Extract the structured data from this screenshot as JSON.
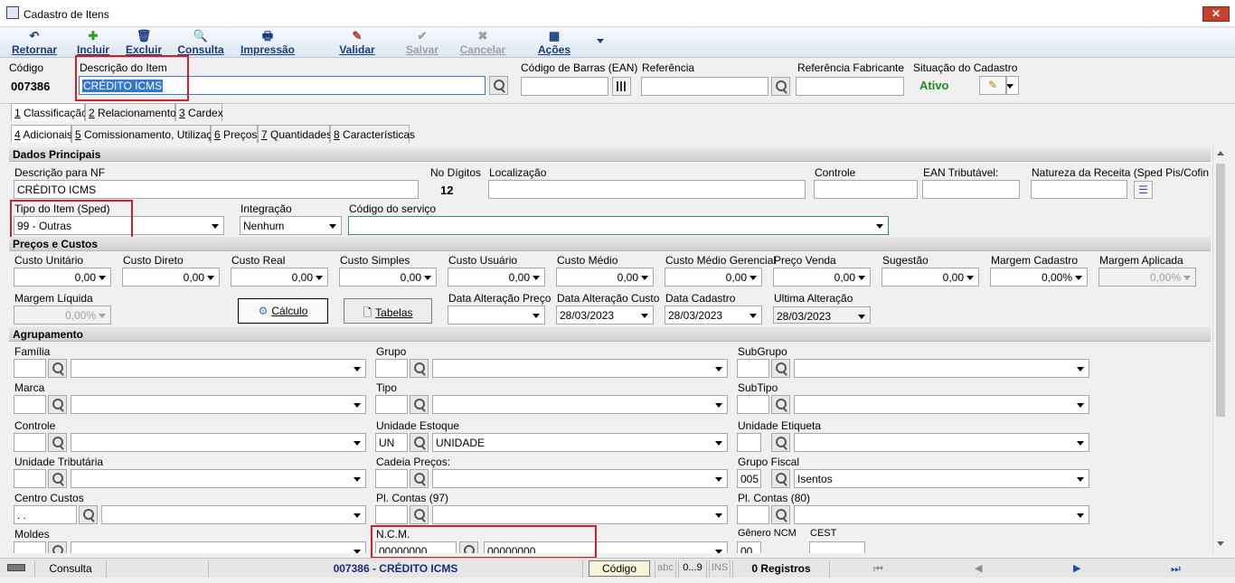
{
  "window": {
    "title": "Cadastro de Itens",
    "close": "✕"
  },
  "toolbar": [
    {
      "label": "Retornar",
      "icon": "↶",
      "enabled": true
    },
    {
      "label": "Incluir",
      "icon": "✚",
      "enabled": true
    },
    {
      "label": "Excluir",
      "icon": "🗑",
      "enabled": true
    },
    {
      "label": "Consulta",
      "icon": "🔍",
      "enabled": true
    },
    {
      "label": "Impressão",
      "icon": "🖶",
      "enabled": true
    },
    {
      "label": "Validar",
      "icon": "✎",
      "enabled": true
    },
    {
      "label": "Salvar",
      "icon": "✔",
      "enabled": false
    },
    {
      "label": "Cancelar",
      "icon": "✖",
      "enabled": false
    },
    {
      "label": "Ações",
      "icon": "▦",
      "enabled": true
    }
  ],
  "header": {
    "codigo_label": "Código",
    "codigo_value": "007386",
    "descricao_label": "Descrição do Item",
    "descricao_value": "CRÉDITO ICMS",
    "ean_label": "Código de Barras (EAN)",
    "ean_value": "",
    "referencia_label": "Referência",
    "referencia_value": "",
    "ref_fab_label": "Referência Fabricante",
    "ref_fab_value": "",
    "situacao_label": "Situação do Cadastro",
    "situacao_value": "Ativo"
  },
  "tabs_row1": [
    {
      "num": "1",
      "label": " Classificação"
    },
    {
      "num": "2",
      "label": " Relacionamentos"
    },
    {
      "num": "3",
      "label": " Cardex"
    }
  ],
  "tabs_row2": [
    {
      "num": "4",
      "label": " Adicionais"
    },
    {
      "num": "5",
      "label": " Comissionamento, Utilização"
    },
    {
      "num": "6",
      "label": " Preços"
    },
    {
      "num": "7",
      "label": " Quantidades"
    },
    {
      "num": "8",
      "label": " Características"
    }
  ],
  "dados": {
    "title": "Dados Principais",
    "desc_nf_label": "Descrição para NF",
    "desc_nf_value": "CRÉDITO ICMS",
    "no_digitos_label": "No Dígitos",
    "no_digitos_value": "12",
    "localizacao_label": "Localização",
    "localizacao_value": "",
    "controle_label": "Controle",
    "controle_value": "",
    "ean_trib_label": "EAN Tributável:",
    "ean_trib_value": "",
    "natureza_label": "Natureza da Receita (Sped Pis/Cofins",
    "natureza_value": "",
    "tipo_label": "Tipo do Item (Sped)",
    "tipo_value": "99 - Outras",
    "integracao_label": "Integração",
    "integracao_value": "Nenhum",
    "servico_label": "Código do serviço",
    "servico_value": ""
  },
  "precos": {
    "title": "Preços e Custos",
    "row1": [
      {
        "label": "Custo Unitário",
        "value": "0,00",
        "disabled": false
      },
      {
        "label": "Custo Direto",
        "value": "0,00",
        "disabled": false
      },
      {
        "label": "Custo Real",
        "value": "0,00",
        "disabled": false
      },
      {
        "label": "Custo Simples",
        "value": "0,00",
        "disabled": false
      },
      {
        "label": "Custo Usuário",
        "value": "0,00",
        "disabled": false
      },
      {
        "label": "Custo Médio",
        "value": "0,00",
        "disabled": false
      },
      {
        "label": "Custo Médio Gerencial",
        "value": "0,00",
        "disabled": false
      },
      {
        "label": "Preço Venda",
        "value": "0,00",
        "disabled": false
      },
      {
        "label": "Sugestão",
        "value": "0,00",
        "disabled": false
      },
      {
        "label": "Margem Cadastro",
        "value": "0,00%",
        "disabled": false
      },
      {
        "label": "Margem Aplicada",
        "value": "0,00%",
        "disabled": true
      }
    ],
    "margem_liq_label": "Margem Líquida",
    "margem_liq_value": "0,00%",
    "calculo_label": "Cálculo",
    "tabelas_label": "Tabelas",
    "dates": [
      {
        "label": "Data Alteração Preço",
        "value": ""
      },
      {
        "label": "Data Alteração Custo",
        "value": "28/03/2023"
      },
      {
        "label": "Data Cadastro",
        "value": "28/03/2023"
      },
      {
        "label": "Ultima Alteração",
        "value": "28/03/2023"
      }
    ]
  },
  "agrup": {
    "title": "Agrupamento",
    "familia": "Família",
    "grupo": "Grupo",
    "subgrupo": "SubGrupo",
    "marca": "Marca",
    "tipo": "Tipo",
    "subtipo": "SubTipo",
    "controle": "Controle",
    "unid_estoque": "Unidade Estoque",
    "unid_estoque_code": "UN",
    "unid_estoque_desc": "UNIDADE",
    "unid_etiqueta": "Unidade Etiqueta",
    "unid_trib": "Unidade Tributária",
    "cadeia": "Cadeia Preços:",
    "grupo_fiscal": "Grupo Fiscal",
    "grupo_fiscal_code": "005",
    "grupo_fiscal_desc": "Isentos",
    "centro_custos": "Centro Custos",
    "centro_custos_value": " .  .",
    "pl_contas97": "Pl. Contas (97)",
    "pl_contas80": "Pl. Contas (80)",
    "moldes": "Moldes",
    "ncm": "N.C.M.",
    "ncm_code": "00000000",
    "ncm_desc": "00000000",
    "genero_ncm": "Gênero NCM",
    "genero_value": "00",
    "cest": "CEST"
  },
  "status": {
    "mode": "Consulta",
    "item": "007386 - CRÉDITO ICMS",
    "codigo_btn": "Código",
    "abc": "abc",
    "range": "0...9",
    "ins": "INS",
    "registros": "0 Registros"
  }
}
